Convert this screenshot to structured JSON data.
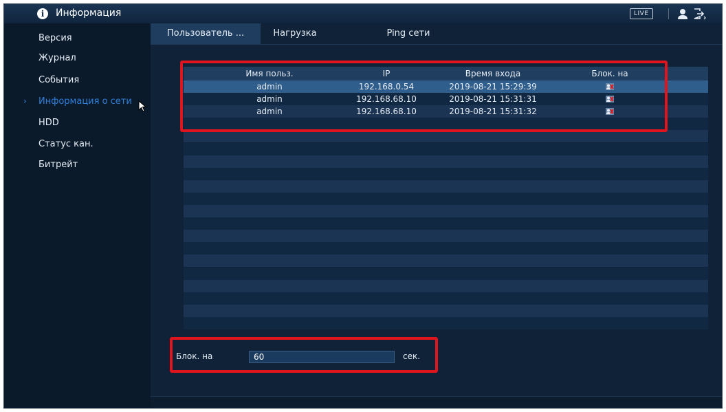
{
  "header": {
    "title": "Информация",
    "live_badge": "LIVE"
  },
  "sidebar": {
    "items": [
      {
        "label": "Версия"
      },
      {
        "label": "Журнал"
      },
      {
        "label": "События"
      },
      {
        "label": "Информация о сети",
        "active": true
      },
      {
        "label": "HDD"
      },
      {
        "label": "Статус кан."
      },
      {
        "label": "Битрейт"
      }
    ]
  },
  "tabs": [
    {
      "label": "Пользователь ...",
      "active": true
    },
    {
      "label": "Нагрузка"
    },
    {
      "label": "Ping сети"
    }
  ],
  "table": {
    "headers": [
      "Имя польз.",
      "IP",
      "Время входа",
      "Блок. на"
    ],
    "rows": [
      {
        "user": "admin",
        "ip": "192.168.0.54",
        "time": "2019-08-21 15:29:39",
        "block_icon": "block-user-icon"
      },
      {
        "user": "admin",
        "ip": "192.168.68.10",
        "time": "2019-08-21 15:31:31",
        "block_icon": "block-user-icon"
      },
      {
        "user": "admin",
        "ip": "192.168.68.10",
        "time": "2019-08-21 15:31:32",
        "block_icon": "block-user-icon"
      }
    ]
  },
  "block_duration": {
    "label": "Блок. на",
    "value": "60",
    "unit": "сек."
  },
  "colors": {
    "accent": "#2f7fd8",
    "highlight": "#e0141c",
    "background": "#0b1a2b"
  }
}
